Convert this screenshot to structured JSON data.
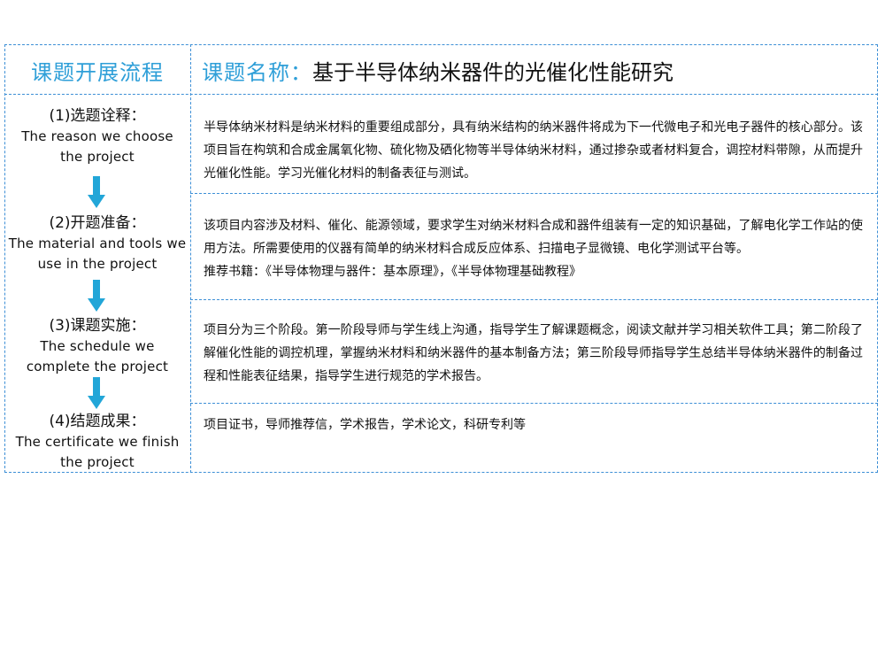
{
  "header": {
    "left_title": "课题开展流程",
    "topic_label": "课题名称：",
    "topic_name": "基于半导体纳米器件的光催化性能研究"
  },
  "steps": [
    {
      "title": "(1)选题诠释：",
      "english_1": "The reason we choose",
      "english_2": "the project"
    },
    {
      "title": "(2)开题准备：",
      "english_1": "The material and tools we",
      "english_2": "use in the project"
    },
    {
      "title": "(3)课题实施：",
      "english_1": "The schedule we",
      "english_2": "complete the project"
    },
    {
      "title": "(4)结题成果：",
      "english_1": "The certificate we finish",
      "english_2": "the project"
    }
  ],
  "content": [
    {
      "text": "半导体纳米材料是纳米材料的重要组成部分，具有纳米结构的纳米器件将成为下一代微电子和光电子器件的核心部分。该项目旨在构筑和合成金属氧化物、硫化物及硒化物等半导体纳米材料，通过掺杂或者材料复合，调控材料带隙，从而提升光催化性能。学习光催化材料的制备表征与测试。"
    },
    {
      "text": "该项目内容涉及材料、催化、能源领域，要求学生对纳米材料合成和器件组装有一定的知识基础，了解电化学工作站的使用方法。所需要使用的仪器有简单的纳米材料合成反应体系、扫描电子显微镜、电化学测试平台等。",
      "books": "推荐书籍：《半导体物理与器件：基本原理》，《半导体物理基础教程》"
    },
    {
      "text": "项目分为三个阶段。第一阶段导师与学生线上沟通，指导学生了解课题概念，阅读文献并学习相关软件工具；第二阶段了解催化性能的调控机理，掌握纳米材料和纳米器件的基本制备方法；第三阶段导师指导学生总结半导体纳米器件的制备过程和性能表征结果，指导学生进行规范的学术报告。"
    },
    {
      "text": "项目证书，导师推荐信，学术报告，学术论文，科研专利等"
    }
  ],
  "colors": {
    "accent": "#2f9fd8",
    "border": "#3d8fd6",
    "arrow": "#22a6d8"
  }
}
